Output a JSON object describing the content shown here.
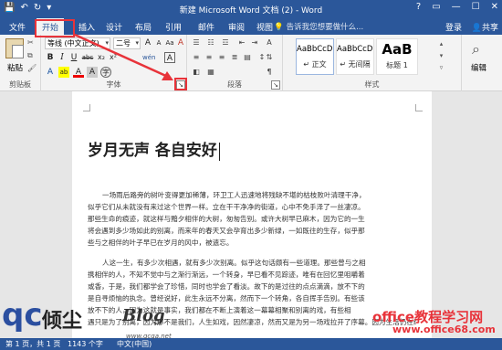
{
  "window": {
    "title": "新建 Microsoft Word 文档 (2) - Word",
    "qat": [
      "save-icon",
      "undo-icon",
      "redo-icon",
      "customize-icon"
    ],
    "controls": [
      "?",
      "▭",
      "—",
      "☐",
      "✕"
    ]
  },
  "tabs": [
    {
      "label": "文件",
      "active": false
    },
    {
      "label": "开始",
      "active": true
    },
    {
      "label": "插入",
      "active": false
    },
    {
      "label": "设计",
      "active": false
    },
    {
      "label": "布局",
      "active": false
    },
    {
      "label": "引用",
      "active": false
    },
    {
      "label": "邮件",
      "active": false
    },
    {
      "label": "审阅",
      "active": false
    },
    {
      "label": "视图",
      "active": false
    }
  ],
  "tell_me": "告诉我您想要做什么...",
  "account": {
    "signin": "登录",
    "share": "共享"
  },
  "ribbon": {
    "clipboard": {
      "paste": "粘贴",
      "label": "剪贴板"
    },
    "font": {
      "font_name": "等线 (中文正文)",
      "font_size": "二号",
      "grow": "A",
      "shrink": "A",
      "change_case": "Aa",
      "clear": "A",
      "wen": "wén",
      "char_border": "A",
      "bold": "B",
      "italic": "I",
      "underline": "U",
      "strike": "abc",
      "sub": "x₂",
      "sup": "x²",
      "effects": "A",
      "highlight": "ab",
      "color": "A",
      "shade": "A",
      "circle": "字",
      "label": "字体"
    },
    "paragraph": {
      "label": "段落"
    },
    "styles": {
      "items": [
        {
          "preview": "AaBbCcDı",
          "name": "↵ 正文"
        },
        {
          "preview": "AaBbCcDı",
          "name": "↵ 无间隔"
        },
        {
          "preview": "AaB",
          "name": "标题 1"
        }
      ],
      "label": "样式"
    },
    "editing": {
      "label": "编辑"
    }
  },
  "document": {
    "title": "岁月无声  各自安好",
    "para1": [
      "一场雨后路旁的树叶变得更加稀薄，环卫工人迅速地将残缺不堪的枯枝败叶清理干净，",
      "似乎它们从未就没有来过这个世界一样。立在干干净净的街道，心中不免手泽了一丝凄凉。",
      "那些生命的痕迹，就这样与黯夕相伴的大树，匆匆告别。或许大树早已麻木，因为它的一生",
      "将会遇到多少场如此的别离，而来年的春天又会孕育出多少新绿，一如既往的生存，似乎那",
      "些与之相伴的叶子早已在岁月的风中，被遗忘。"
    ],
    "para2": [
      "人这一生，有多少次相遇，就有多少次别离。似乎这句话颇有一些道理。那些曾与之相",
      "携相伴的人，不知不觉中与之渐行渐远，一个转身，早已看不见踪迹，唯有在回忆里咀嚼着",
      "或香，于是，我们都学会了珍惜，同时也学会了看淡。故下的是过往的点点滴滴，放不下的",
      "是自寻烦恼的执念。曾经说好，此生永远不分离，然而下一个转角，各自挥手告别。有些该",
      "放不下的人，因为这就是事实，我们都在不断上演着这一幕幕相聚和别离的戏，有些相",
      "遇只是为了别离，因为那不是我们，人生如戏，因然凄凉，然而又是为另一场戏拉开了序幕。因为生活仍在继"
    ]
  },
  "status": {
    "page": "第 1 页，共 1 页",
    "words": "1143 个字",
    "lang": "中文(中国)"
  },
  "watermark": {
    "logo": "qc",
    "text": "倾尘",
    "blog": "Blog",
    "url1": "www.qcqa.net",
    "site": "office教程学习网",
    "url2": "www.office68.com"
  },
  "colors": {
    "brand": "#2b579a",
    "highlight": "#e8333a"
  }
}
